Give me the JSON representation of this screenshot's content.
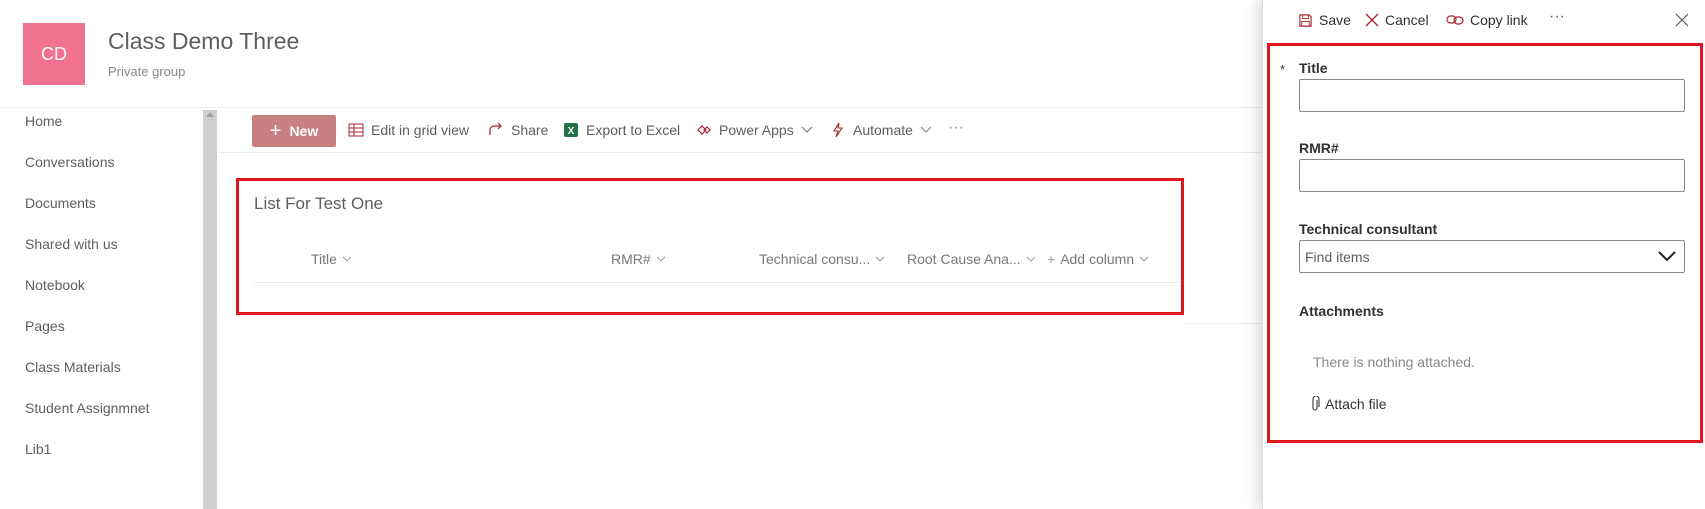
{
  "site": {
    "initials": "CD",
    "title": "Class Demo Three",
    "subtitle": "Private group"
  },
  "nav": {
    "items": [
      {
        "label": "Home"
      },
      {
        "label": "Conversations"
      },
      {
        "label": "Documents"
      },
      {
        "label": "Shared with us"
      },
      {
        "label": "Notebook"
      },
      {
        "label": "Pages"
      },
      {
        "label": "Class Materials"
      },
      {
        "label": "Student Assignmnet"
      },
      {
        "label": "Lib1"
      }
    ]
  },
  "commandbar": {
    "new_label": "New",
    "edit_grid": "Edit in grid view",
    "share": "Share",
    "export": "Export to Excel",
    "power_apps": "Power Apps",
    "automate": "Automate",
    "more": "···"
  },
  "list": {
    "title": "List For Test One",
    "columns": [
      {
        "label": "Title"
      },
      {
        "label": "RMR#"
      },
      {
        "label": "Technical consu..."
      },
      {
        "label": "Root Cause Ana..."
      },
      {
        "label": "Add column"
      }
    ]
  },
  "panel": {
    "save": "Save",
    "cancel": "Cancel",
    "copy_link": "Copy link",
    "more": "···",
    "required_marker": "*",
    "fields": {
      "title_label": "Title",
      "title_value": "",
      "rmr_label": "RMR#",
      "rmr_value": "",
      "consultant_label": "Technical consultant",
      "consultant_placeholder": "Find items",
      "attachments_label": "Attachments",
      "attachments_empty": "There is nothing attached.",
      "attach_file": "Attach file"
    }
  },
  "colors": {
    "accent": "#c98080",
    "avatar": "#f0728e",
    "highlight_border": "#e0161f",
    "icon_red": "#a4262c"
  },
  "icons": [
    "plus-icon",
    "grid-icon",
    "share-icon",
    "excel-icon",
    "power-apps-icon",
    "automate-icon",
    "chevron-down-icon",
    "save-icon",
    "cancel-icon",
    "link-icon",
    "close-icon",
    "paperclip-icon"
  ]
}
